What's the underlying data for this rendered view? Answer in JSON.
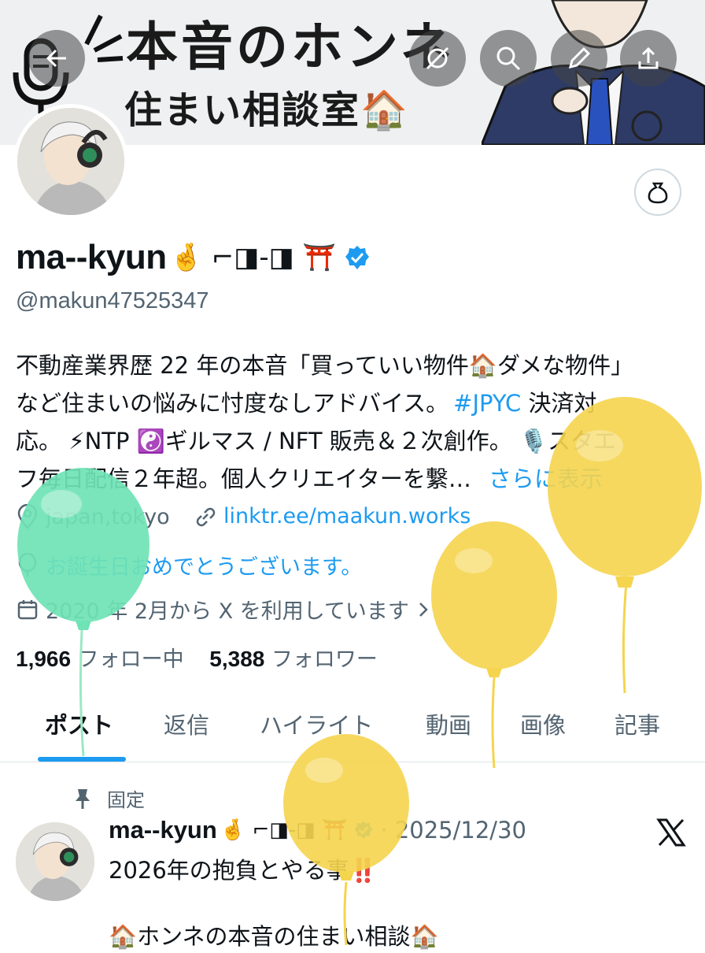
{
  "banner": {
    "title_line1": "本音のホンネ",
    "title_line2": "住まい相談室🏠"
  },
  "toolbar": {
    "back_icon": "arrow-left-icon",
    "icons": [
      "grok-icon",
      "search-icon",
      "edit-icon",
      "share-icon"
    ]
  },
  "profile": {
    "name": "ma--kyun",
    "name_emoji": "🤞 ⌐◨-◨ ⛩️",
    "handle": "@makun47525347",
    "bio_lines": [
      "不動産業界歴 22 年の本音「買っていい物件🏠ダメな物件」",
      "など住まいの悩みに忖度なしアドバイス。",
      "応。 ⚡NTP ☯️ギルマス / NFT 販売＆２次創作。 🎙️スタエ",
      "フ毎日配信２年超。個人クリエイターを繋…"
    ],
    "bio_hashtag": "#JPYC",
    "bio_line2_end": " 決済対",
    "bio_more": "さらに表示",
    "location": "japan,tokyo",
    "website": "linktr.ee/maakun.works",
    "birthday": "お誕生日おめでとうございます。",
    "joined": "2020 年 2月から X を利用しています",
    "following_count": "1,966",
    "following_label": "フォロー中",
    "followers_count": "5,388",
    "followers_label": "フォロワー"
  },
  "tabs": [
    "ポスト",
    "返信",
    "ハイライト",
    "動画",
    "画像",
    "記事"
  ],
  "post": {
    "pinned_label": "固定",
    "author": "ma--kyun",
    "author_emoji": "🤞 ⌐◨-◨ ⛩️",
    "date": "· 2025/12/30",
    "text_line1": "2026年の抱負とやる事‼️",
    "text_line2": "",
    "text_line3": "🏠ホンネの本音の住まい相談🏠"
  },
  "colors": {
    "accent": "#1d9bf0",
    "balloon_green": "#6fe3b5",
    "balloon_yellow": "#f5d44e"
  }
}
